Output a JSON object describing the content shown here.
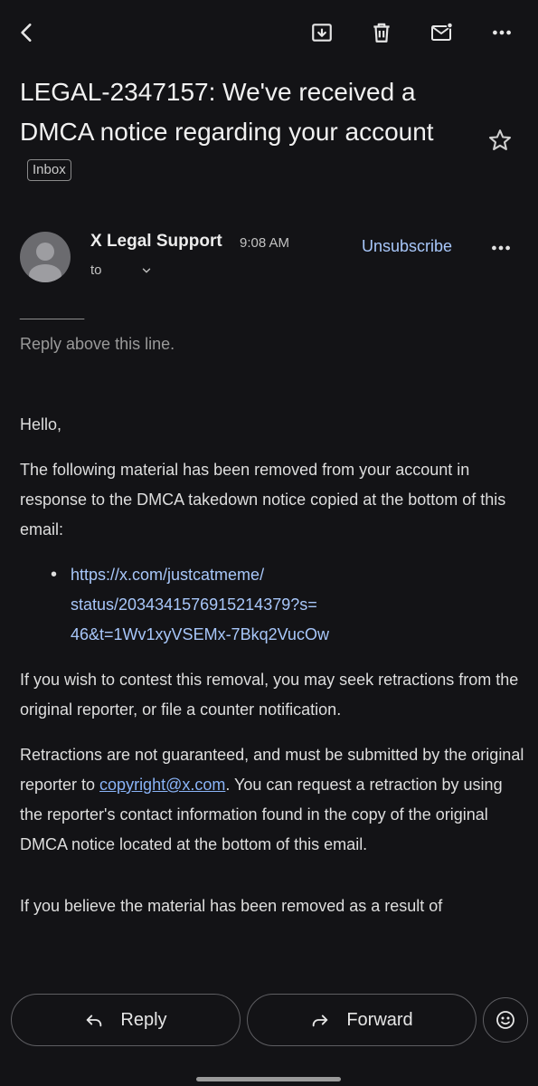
{
  "header": {
    "back_icon": "back-arrow-icon",
    "archive_icon": "archive-icon",
    "delete_icon": "trash-icon",
    "mark_unread_icon": "mark-unread-icon",
    "more_icon": "more-horizontal-icon"
  },
  "subject": {
    "text": "LEGAL-2347157: We've received a DMCA notice regarding your account",
    "label_chip": "Inbox"
  },
  "message": {
    "sender_name": "X Legal Support",
    "time": "9:08 AM",
    "to_label": "to",
    "unsubscribe_label": "Unsubscribe"
  },
  "body": {
    "separator": "________",
    "reply_hint": "Reply above this line.",
    "greeting": "Hello,",
    "para1": "The following material has been removed from your account in response to the DMCA takedown notice copied at the bottom of this email:",
    "link_line1": "https://x.com/justcatmeme/",
    "link_line2": "status/2034341576915214379?s=",
    "link_line3": "46&t=1Wv1xyVSEMx-7Bkq2VucOw",
    "para2": "If you wish to contest this removal, you may seek retractions from the original reporter, or file a counter notification.",
    "para3_before": "Retractions are not guaranteed, and must be submitted by the original reporter to ",
    "para3_email": "copyright@x.com",
    "para3_after": ". You can request a retraction by using the reporter's contact information found in the copy of the original DMCA notice located at the bottom of this email.",
    "para4": "If you believe the material has been removed as a result of"
  },
  "actions": {
    "reply_label": "Reply",
    "forward_label": "Forward"
  },
  "colors": {
    "background": "#131316",
    "link": "#a8c7fa"
  }
}
